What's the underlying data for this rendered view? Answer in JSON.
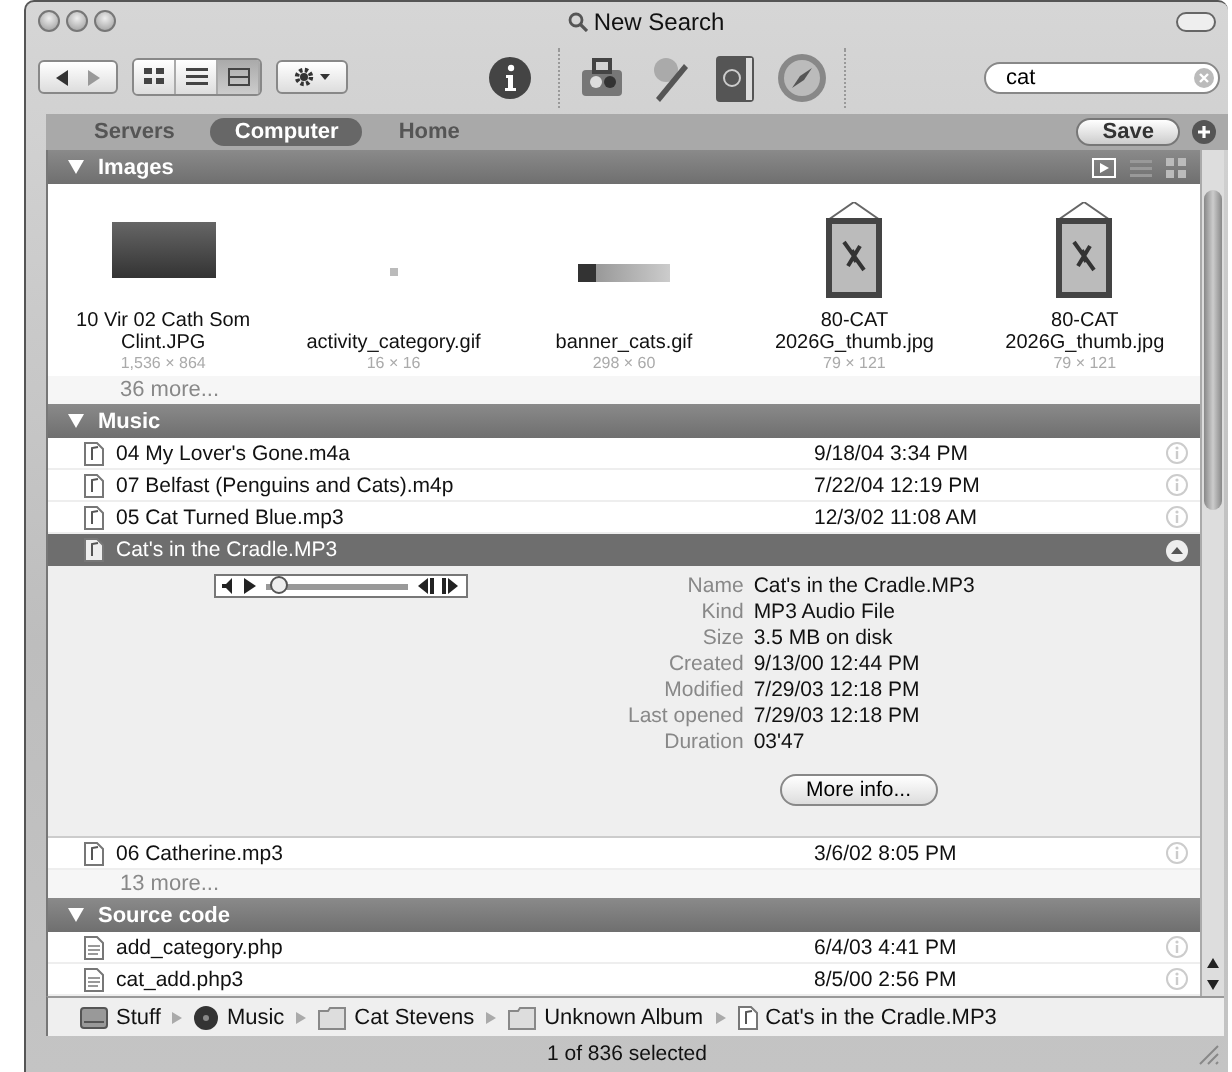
{
  "window": {
    "title": "New Search"
  },
  "toolbar": {
    "view_buttons": [
      {
        "kind": "icon",
        "selected": false
      },
      {
        "kind": "list",
        "selected": false
      },
      {
        "kind": "column",
        "selected": true
      }
    ],
    "search": {
      "value": "cat"
    }
  },
  "scopes": [
    {
      "label": "Servers",
      "selected": false
    },
    {
      "label": "Computer",
      "selected": true
    },
    {
      "label": "Home",
      "selected": false
    }
  ],
  "save_button": "Save",
  "sections": [
    {
      "kind": "images",
      "title": "Images",
      "items": [
        {
          "name": "10 Vir 02 Cath Som Clint.JPG",
          "dims": "1,536 × 864",
          "kind": "photo"
        },
        {
          "name": "activity_category.gif",
          "dims": "16 × 16",
          "kind": "dot"
        },
        {
          "name": "banner_cats.gif",
          "dims": "298 × 60",
          "kind": "banner"
        },
        {
          "name": "80-CAT 2026G_thumb.jpg",
          "dims": "79 × 121",
          "kind": "scroll"
        },
        {
          "name": "80-CAT 2026G_thumb.jpg",
          "dims": "79 × 121",
          "kind": "scroll"
        }
      ],
      "more": "36 more..."
    },
    {
      "kind": "list",
      "title": "Music",
      "rows": [
        {
          "name": "04 My Lover's Gone.m4a",
          "date": "9/18/04 3:34 PM",
          "selected": false
        },
        {
          "name": "07 Belfast (Penguins and Cats).m4p",
          "date": "7/22/04 12:19 PM",
          "selected": false
        },
        {
          "name": "05 Cat Turned Blue.mp3",
          "date": "12/3/02 11:08 AM",
          "selected": false
        },
        {
          "name": "Cat's in the Cradle.MP3",
          "selected": true,
          "detail": {
            "player": {
              "level": 0.05
            },
            "fields": [
              {
                "label": "Name",
                "value": "Cat's in the Cradle.MP3"
              },
              {
                "label": "Kind",
                "value": "MP3 Audio File"
              },
              {
                "label": "Size",
                "value": "3.5 MB on disk"
              },
              {
                "label": "Created",
                "value": "9/13/00 12:44 PM"
              },
              {
                "label": "Modified",
                "value": "7/29/03 12:18 PM"
              },
              {
                "label": "Last opened",
                "value": "7/29/03 12:18 PM"
              },
              {
                "label": "Duration",
                "value": "03'47"
              }
            ],
            "button": "More info..."
          }
        },
        {
          "name": "06 Catherine.mp3",
          "date": "3/6/02 8:05 PM",
          "selected": false
        }
      ],
      "more": "13 more..."
    },
    {
      "kind": "list",
      "title": "Source code",
      "rows": [
        {
          "name": "add_category.php",
          "date": "6/4/03 4:41 PM",
          "selected": false
        },
        {
          "name": "cat_add.php3",
          "date": "8/5/00 2:56 PM",
          "selected": false
        }
      ]
    }
  ],
  "path": [
    {
      "label": "Stuff",
      "kind": "disk"
    },
    {
      "label": "Music",
      "kind": "disc"
    },
    {
      "label": "Cat Stevens",
      "kind": "folder"
    },
    {
      "label": "Unknown Album",
      "kind": "folder"
    },
    {
      "label": "Cat's in the Cradle.MP3",
      "kind": "file"
    }
  ],
  "status_bar": "1 of 836 selected"
}
